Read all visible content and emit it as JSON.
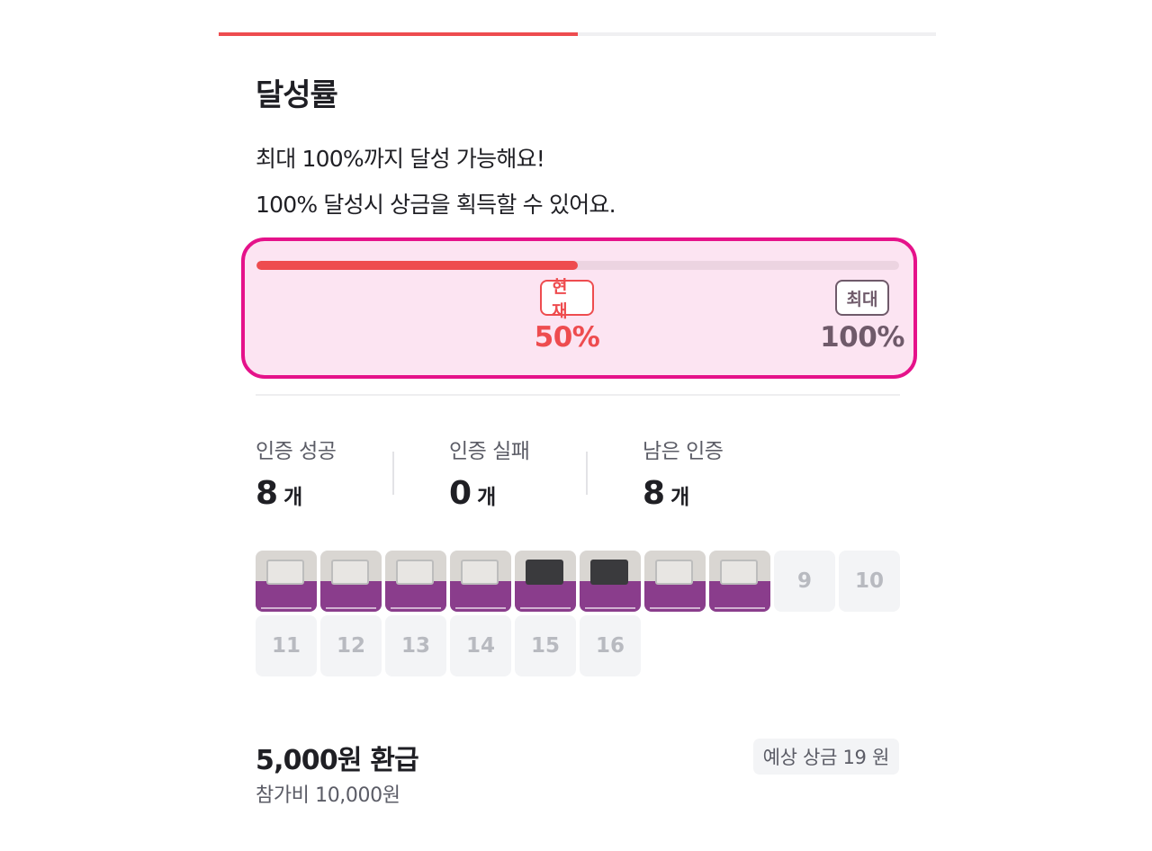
{
  "top_progress": {
    "fraction": 0.5
  },
  "section": {
    "title": "달성률",
    "desc_1": "최대 100%까지 달성 가능해요!",
    "desc_2": "100% 달성시 상금을 획득할 수 있어요."
  },
  "achievement": {
    "progress_fraction": 0.5,
    "current_label": "현재",
    "current_value": "50%",
    "max_label": "최대",
    "max_value": "100%",
    "highlight_color": "#e5128a",
    "accent_color": "#ee4c4f"
  },
  "stats": {
    "success": {
      "label": "인증 성공",
      "count": "8",
      "unit": "개"
    },
    "fail": {
      "label": "인증 실패",
      "count": "0",
      "unit": "개"
    },
    "remaining": {
      "label": "남은 인증",
      "count": "8",
      "unit": "개"
    }
  },
  "certification_grid": {
    "photos": [
      {
        "icon": "photo-thumbnail",
        "device": "light"
      },
      {
        "icon": "photo-thumbnail",
        "device": "light"
      },
      {
        "icon": "photo-thumbnail",
        "device": "light"
      },
      {
        "icon": "photo-thumbnail",
        "device": "light"
      },
      {
        "icon": "photo-thumbnail",
        "device": "dark"
      },
      {
        "icon": "photo-thumbnail",
        "device": "dark"
      },
      {
        "icon": "photo-thumbnail",
        "device": "light"
      },
      {
        "icon": "photo-thumbnail",
        "device": "light"
      }
    ],
    "empty_slots": [
      "9",
      "10",
      "11",
      "12",
      "13",
      "14",
      "15",
      "16"
    ]
  },
  "reward": {
    "refund": "5,000원 환급",
    "fee": "참가비 10,000원",
    "expected_prize": "예상 상금 19 원"
  }
}
